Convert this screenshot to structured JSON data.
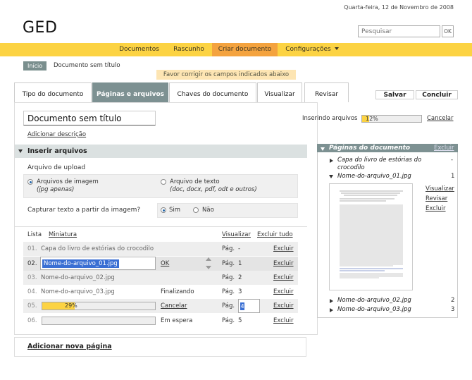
{
  "header": {
    "date": "Quarta-feira, 12 de Novembro de 2008",
    "logo": "GED",
    "search_placeholder": "Pesquisar",
    "search_ok": "OK"
  },
  "menu": [
    {
      "label": "Documentos"
    },
    {
      "label": "Rascunho"
    },
    {
      "label": "Criar documento",
      "active": true
    },
    {
      "label": "Configurações"
    }
  ],
  "breadcrumb": {
    "home": "Início",
    "current": "Documento sem título"
  },
  "alert": "Favor corrigir os campos indicados abaixo",
  "tabs": [
    {
      "label": "Tipo do documento"
    },
    {
      "label": "Páginas e arquivos",
      "active": true
    },
    {
      "label": "Chaves do documento"
    },
    {
      "label": "Visualizar"
    },
    {
      "label": "Revisar"
    }
  ],
  "actions": {
    "save": "Salvar",
    "finish": "Concluir"
  },
  "doc": {
    "title": "Documento sem título",
    "add_description": "Adicionar descrição",
    "inserting_label": "Inserindo arquivos",
    "inserting_progress": 0.12,
    "inserting_pct_text": "12%",
    "cancel": "Cancelar"
  },
  "insert_section": {
    "title": "Inserir arquivos",
    "upload_label": "Arquivo de upload",
    "options": [
      {
        "title": "Arquivos de imagem",
        "sub": "(jpg apenas)",
        "selected": true
      },
      {
        "title": "Arquivo de texto",
        "sub": "(doc, docx, pdf, odt e outros)",
        "selected": false
      }
    ],
    "capture_label": "Capturar texto a partir da imagem?",
    "capture_yes": "Sim",
    "capture_no": "Não"
  },
  "list_header": {
    "lista": "Lista",
    "miniatura": "Miniatura",
    "visualizar": "Visualizar",
    "excluir_tudo": "Excluir tudo"
  },
  "rows": [
    {
      "num": "01.",
      "name": "Capa do livro de estórias do crocodilo",
      "status": "",
      "pag": "Pág.",
      "page": "-",
      "del": "Excluir"
    },
    {
      "num": "02.",
      "name": "Nome-do-arquivo_01.jpg",
      "ok": "OK",
      "pag": "Pág.",
      "page": "1",
      "del": "Excluir"
    },
    {
      "num": "03.",
      "name": "Nome-do-arquivo_02.jpg",
      "status": "",
      "pag": "Pág.",
      "page": "2",
      "del": "Excluir"
    },
    {
      "num": "04.",
      "name": "Nome-do-arquivo_03.jpg",
      "status": "Finalizando",
      "pag": "Pág.",
      "page": "3",
      "del": "Excluir"
    },
    {
      "num": "05.",
      "progress": 0.29,
      "pct_text": "29%",
      "status": "Cancelar",
      "pag": "Pág.",
      "page": "4",
      "del": "Excluir"
    },
    {
      "num": "06.",
      "progress": 0,
      "status": "Em espera",
      "pag": "Pág.",
      "page": "5",
      "del": "Excluir"
    }
  ],
  "add_page": "Adicionar nova página",
  "pages_panel": {
    "title": "Páginas do documento",
    "delete": "Excluir",
    "items": [
      {
        "name": "Capa do livro de estórias do crocodilo",
        "num": "-"
      },
      {
        "name": "Nome-do-arquivo_01.jpg",
        "num": "1"
      },
      {
        "name": "Nome-do-arquivo_02.jpg",
        "num": "2"
      },
      {
        "name": "Nome-do-arquivo_03.jpg",
        "num": "3"
      }
    ],
    "actions": {
      "view": "Visualizar",
      "review": "Revisar",
      "delete": "Excluir"
    }
  }
}
